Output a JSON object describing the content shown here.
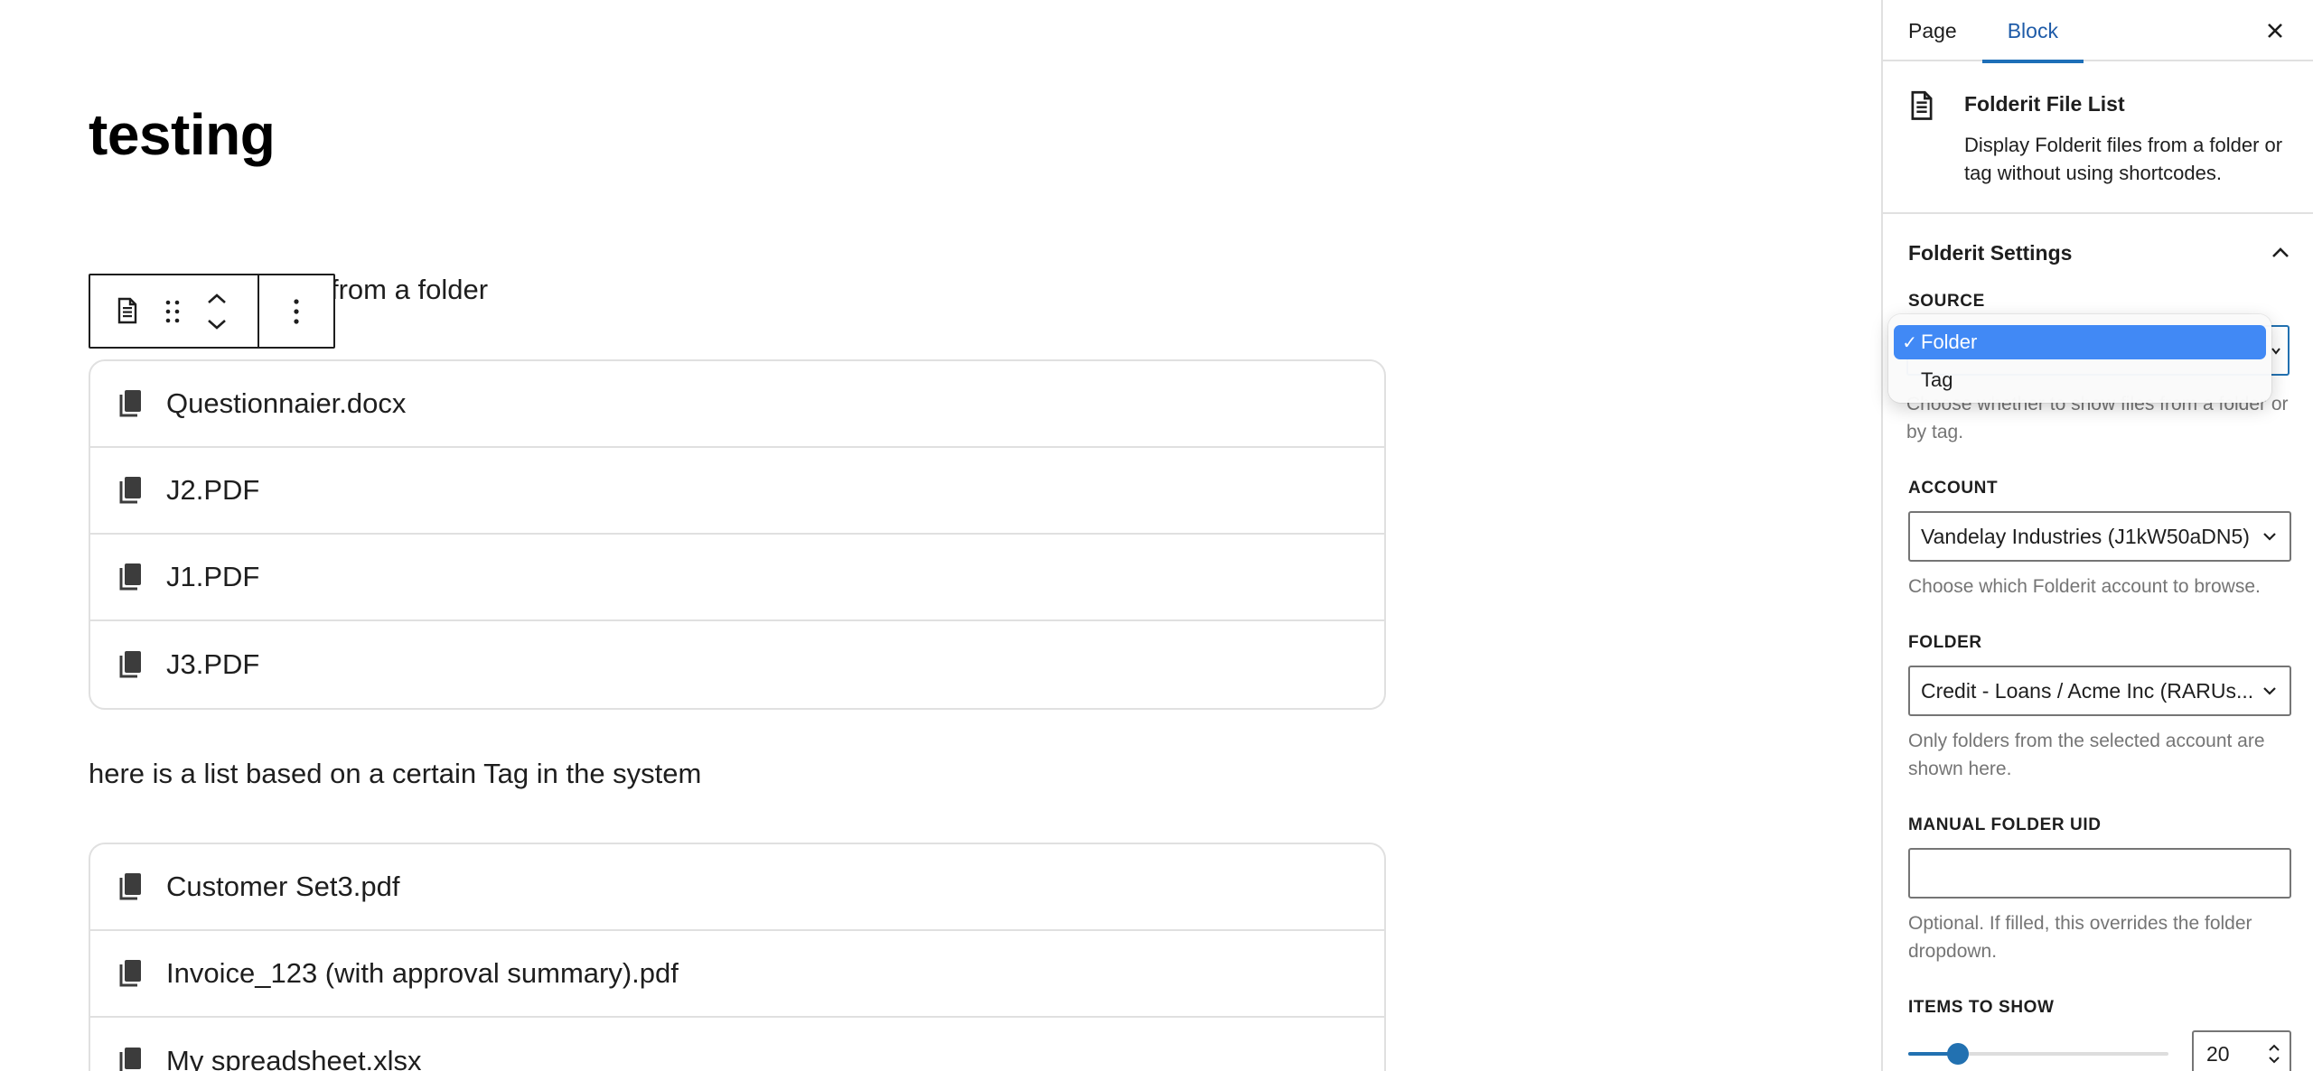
{
  "editor": {
    "post_title": "testing",
    "paragraph_1_visible": "from a folder",
    "paragraph_2": "here is a list based on a certain Tag in the system",
    "folder_files": [
      "Questionnaier.docx",
      "J2.PDF",
      "J1.PDF",
      "J3.PDF"
    ],
    "tag_files": [
      "Customer Set3.pdf",
      "Invoice_123 (with approval summary).pdf",
      "My spreadsheet.xlsx"
    ],
    "toolbar": {
      "block_type_icon": "document-icon",
      "drag_icon": "drag-handle-icon",
      "move_icon": "chevron-up-down-icon",
      "options_icon": "more-vertical-icon"
    }
  },
  "sidebar": {
    "tabs": [
      {
        "label": "Page",
        "active": false
      },
      {
        "label": "Block",
        "active": true
      }
    ],
    "close_icon": "close-icon",
    "block": {
      "icon": "document-icon",
      "title": "Folderit File List",
      "description": "Display Folderit files from a folder or tag without using shortcodes."
    },
    "settings": {
      "title": "Folderit Settings",
      "collapse_icon": "chevron-up-icon",
      "source": {
        "label": "Source",
        "options": [
          "Folder",
          "Tag"
        ],
        "selected": "Folder",
        "help": "Choose whether to show files from a folder or by tag."
      },
      "account": {
        "label": "Account",
        "value": "Vandelay Industries (J1kW50aDN5)",
        "help": "Choose which Folderit account to browse."
      },
      "folder": {
        "label": "Folder",
        "value": "Credit - Loans / Acme Inc (RARUs...",
        "help": "Only folders from the selected account are shown here."
      },
      "manual_folder_uid": {
        "label": "Manual Folder UID",
        "value": "",
        "help": "Optional. If filled, this overrides the folder dropdown."
      },
      "items_to_show": {
        "label": "Items to show",
        "value": "20",
        "fraction": 0.19
      }
    }
  },
  "colors": {
    "accent": "#2271b1",
    "dropdown_highlight": "#4189f5",
    "border": "#e0e0e0",
    "help_text": "#757575"
  }
}
